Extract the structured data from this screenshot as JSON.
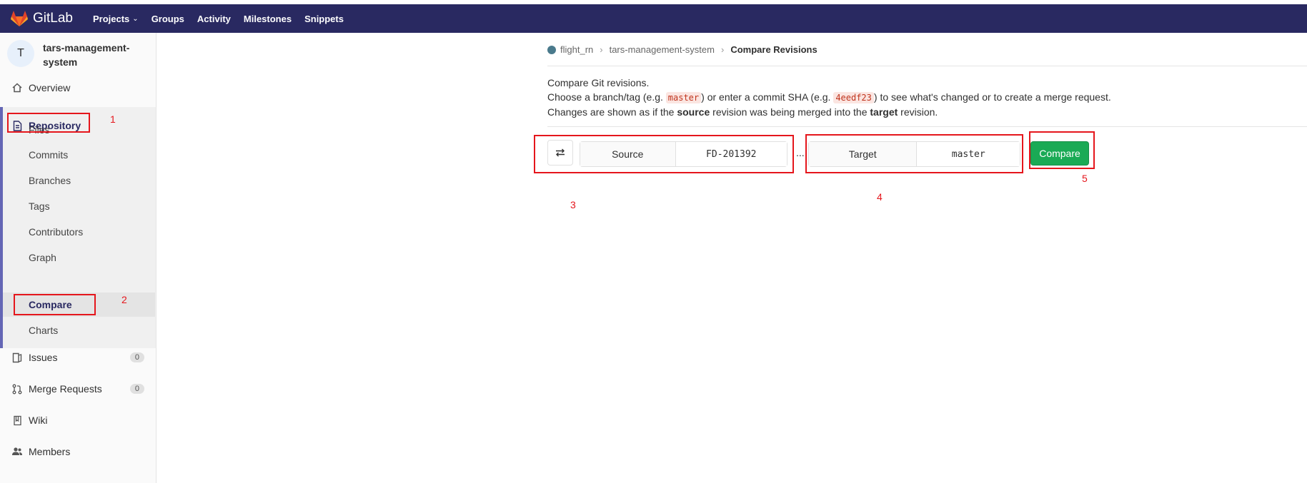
{
  "navbar": {
    "brand": "GitLab",
    "links": [
      {
        "label": "Projects",
        "has_dropdown": true
      },
      {
        "label": "Groups"
      },
      {
        "label": "Activity"
      },
      {
        "label": "Milestones"
      },
      {
        "label": "Snippets"
      }
    ]
  },
  "sidebar": {
    "project_initial": "T",
    "project_name": "tars-management-system",
    "overview": "Overview",
    "repository": "Repository",
    "repo_items": [
      "Files",
      "Commits",
      "Branches",
      "Tags",
      "Contributors",
      "Graph",
      "Compare",
      "Charts"
    ],
    "issues": {
      "label": "Issues",
      "count": "0"
    },
    "merge_requests": {
      "label": "Merge Requests",
      "count": "0"
    },
    "wiki": "Wiki",
    "members": "Members"
  },
  "breadcrumb": {
    "group": "flight_rn",
    "project": "tars-management-system",
    "current": "Compare Revisions"
  },
  "description": {
    "line1": "Compare Git revisions.",
    "line2_a": "Choose a branch/tag (e.g. ",
    "line2_code1": "master",
    "line2_b": ") or enter a commit SHA (e.g. ",
    "line2_code2": "4eedf23",
    "line2_c": ") to see what's changed or to create a merge request.",
    "line3_a": "Changes are shown as if the ",
    "line3_bold1": "source",
    "line3_b": " revision was being merged into the ",
    "line3_bold2": "target",
    "line3_c": " revision."
  },
  "compare_form": {
    "source_label": "Source",
    "source_value": "FD-201392",
    "separator": "...",
    "target_label": "Target",
    "target_value": "master",
    "compare_button": "Compare"
  },
  "annotations": [
    "1",
    "2",
    "3",
    "4",
    "5"
  ],
  "colors": {
    "navbar": "#292961",
    "sidebar_accent": "#6466b5",
    "annotation": "#e5161c",
    "compare_button": "#1aaa55"
  }
}
